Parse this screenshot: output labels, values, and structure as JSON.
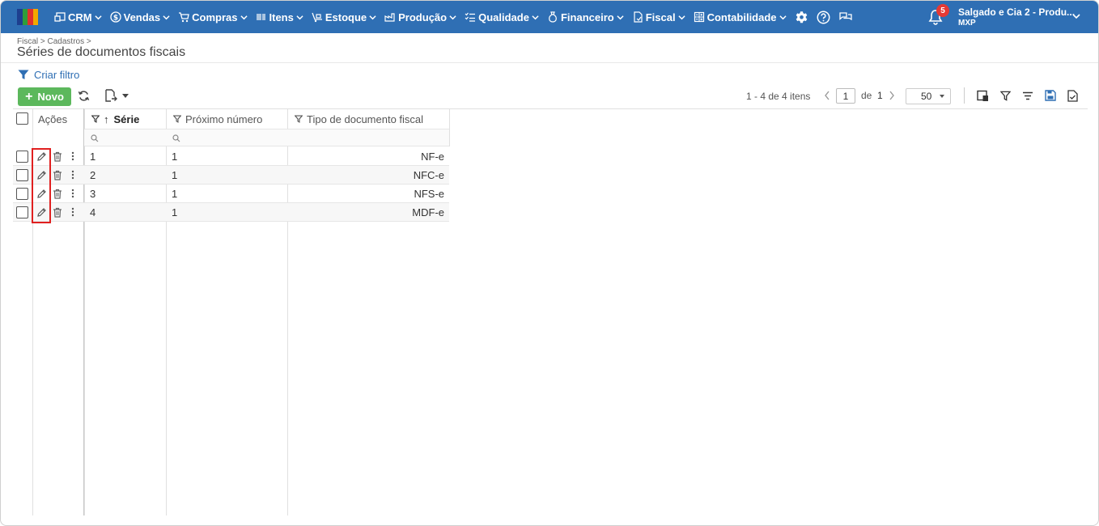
{
  "app": {
    "nav": [
      {
        "label": "CRM",
        "icon": "crm-icon"
      },
      {
        "label": "Vendas",
        "icon": "dollar-icon"
      },
      {
        "label": "Compras",
        "icon": "cart-icon"
      },
      {
        "label": "Itens",
        "icon": "barcode-icon"
      },
      {
        "label": "Estoque",
        "icon": "dolly-icon"
      },
      {
        "label": "Produção",
        "icon": "factory-icon"
      },
      {
        "label": "Qualidade",
        "icon": "checklist-icon"
      },
      {
        "label": "Financeiro",
        "icon": "moneybag-icon"
      },
      {
        "label": "Fiscal",
        "icon": "document-icon"
      },
      {
        "label": "Contabilidade",
        "icon": "calculator-icon"
      }
    ],
    "notifications_count": "5",
    "company_name": "Salgado e Cia 2 - Produ...",
    "company_sub": "MXP",
    "colors": {
      "topbar": "#2f6fb4",
      "accent": "#2f6fb4",
      "success": "#5cb85c",
      "badge": "#e53935"
    }
  },
  "header": {
    "breadcrumb": "Fiscal > Cadastros >",
    "title": "Séries de documentos fiscais"
  },
  "filters": {
    "create_label": "Criar filtro"
  },
  "toolbar": {
    "new_label": "Novo"
  },
  "pager": {
    "info": "1 - 4 de 4 itens",
    "current_page": "1",
    "of_label": "de",
    "total_pages": "1",
    "page_size": "50"
  },
  "table": {
    "columns": {
      "actions": "Ações",
      "serie": "Série",
      "proximo": "Próximo número",
      "tipo": "Tipo de documento fiscal"
    },
    "rows": [
      {
        "serie": "1",
        "proximo": "1",
        "tipo": "NF-e"
      },
      {
        "serie": "2",
        "proximo": "1",
        "tipo": "NFC-e"
      },
      {
        "serie": "3",
        "proximo": "1",
        "tipo": "NFS-e"
      },
      {
        "serie": "4",
        "proximo": "1",
        "tipo": "MDF-e"
      }
    ]
  }
}
